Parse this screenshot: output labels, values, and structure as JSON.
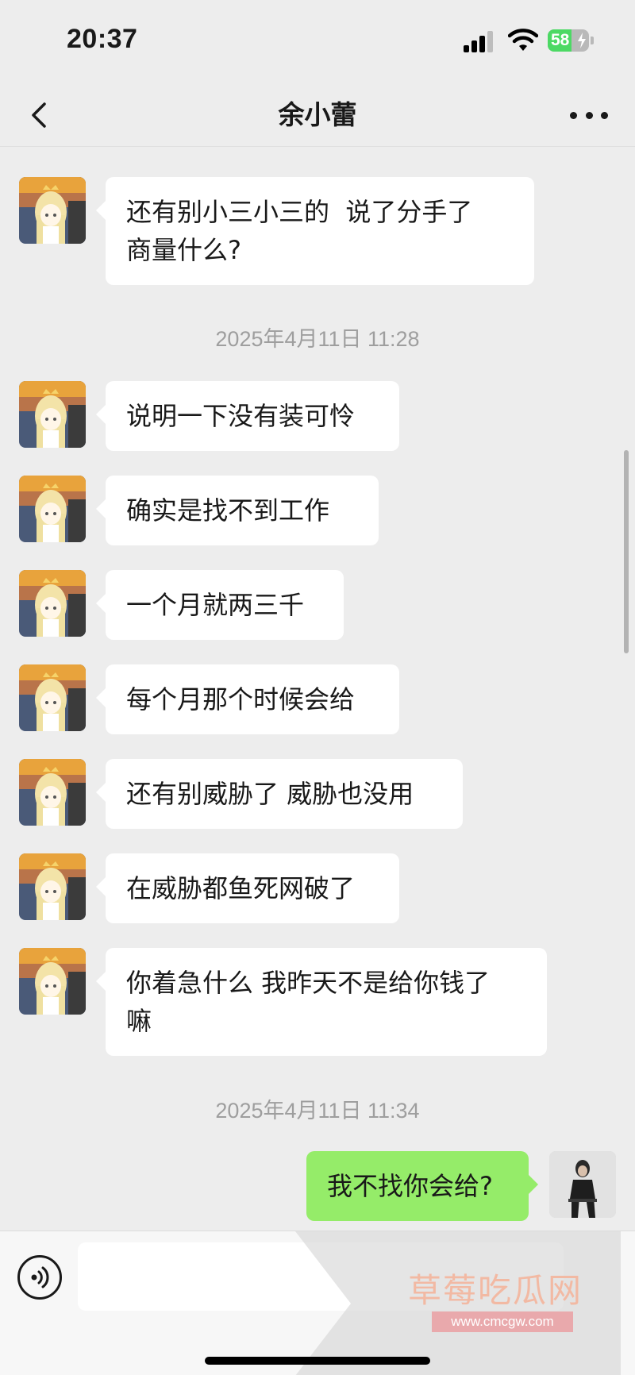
{
  "status_bar": {
    "time": "20:37",
    "battery": "58",
    "battery_level": 0.58
  },
  "nav": {
    "title": "余小蕾",
    "back_icon": "chevron-left-icon",
    "more_icon": "ellipsis-icon"
  },
  "messages": [
    {
      "type": "in",
      "text_lines": [
        "还有别小三小三的  说了分手了",
        "商量什么?"
      ]
    },
    {
      "type": "time",
      "text": "2025年4月11日 11:28"
    },
    {
      "type": "in",
      "text_lines": [
        "说明一下没有装可怜"
      ]
    },
    {
      "type": "in",
      "text_lines": [
        "确实是找不到工作"
      ]
    },
    {
      "type": "in",
      "text_lines": [
        "一个月就两三千"
      ]
    },
    {
      "type": "in",
      "text_lines": [
        "每个月那个时候会给"
      ]
    },
    {
      "type": "in",
      "text_lines": [
        "还有别威胁了 威胁也没用"
      ]
    },
    {
      "type": "in",
      "text_lines": [
        "在威胁都鱼死网破了"
      ]
    },
    {
      "type": "in",
      "text_lines": [
        "你着急什么 我昨天不是给你钱了",
        "嘛"
      ]
    },
    {
      "type": "time",
      "text": "2025年4月11日 11:34"
    },
    {
      "type": "out",
      "text_lines": [
        "我不找你会给?"
      ]
    }
  ],
  "input_bar": {
    "voice_icon": "voice-icon",
    "placeholder": ""
  },
  "watermark": {
    "title": "草莓吃瓜网",
    "url": "www.cmcgw.com"
  },
  "colors": {
    "background": "#ededed",
    "incoming_bubble": "#ffffff",
    "outgoing_bubble": "#95ec69",
    "timestamp": "#9e9e9e"
  }
}
